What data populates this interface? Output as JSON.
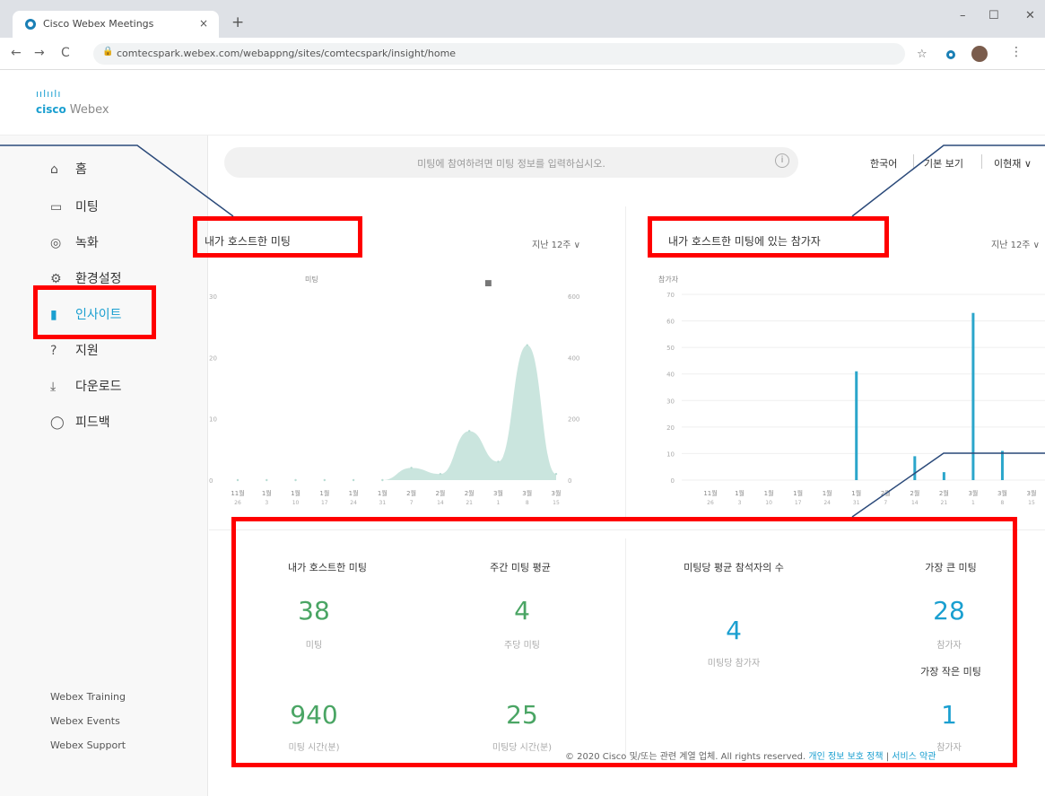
{
  "browser": {
    "tab_title": "Cisco Webex Meetings",
    "tab_close": "×",
    "new_tab": "+",
    "url": "comtecspark.webex.com/webappng/sites/comtecspark/insight/home",
    "minimize": "–",
    "maximize": "☐",
    "close": "✕",
    "back": "←",
    "forward": "→",
    "reload": "C",
    "star": "☆",
    "menu": "⋮"
  },
  "brand": {
    "bars": "ıılıılı",
    "cisco": "cisco",
    "product": "Webex"
  },
  "sidebar": {
    "items": [
      {
        "icon": "home-icon",
        "glyph": "⌂",
        "label": "홈"
      },
      {
        "icon": "calendar-icon",
        "glyph": "▭",
        "label": "미팅"
      },
      {
        "icon": "record-icon",
        "glyph": "◎",
        "label": "녹화"
      },
      {
        "icon": "gear-icon",
        "glyph": "⚙",
        "label": "환경설정"
      },
      {
        "icon": "bar-chart-icon",
        "glyph": "▮",
        "label": "인사이트"
      },
      {
        "icon": "help-icon",
        "glyph": "?",
        "label": "지원"
      },
      {
        "icon": "download-icon",
        "glyph": "⤓",
        "label": "다운로드"
      },
      {
        "icon": "feedback-icon",
        "glyph": "◯",
        "label": "피드백"
      }
    ],
    "footer_links": [
      "Webex Training",
      "Webex Events",
      "Webex Support"
    ]
  },
  "search": {
    "placeholder": "미팅에 참여하려면 미팅 정보를 입력하십시오.",
    "info": "i"
  },
  "header_links": {
    "language": "한국어",
    "classic_view": "기본 보기",
    "user": "이현재 ∨"
  },
  "panels": {
    "meetings_title": "내가 호스트한 미팅",
    "participants_title": "내가 호스트한 미팅에 있는 참가자",
    "period_label": "지난 12주 ∨",
    "period_label_short": "지난 12주 ∨"
  },
  "stats": {
    "hosted_label": "내가 호스트한 미팅",
    "hosted_value": "38",
    "hosted_unit": "미팅",
    "weekly_label": "주간 미팅 평균",
    "weekly_value": "4",
    "weekly_unit": "주당 미팅",
    "avg_participants_label": "미팅당 평균 참석자의 수",
    "avg_participants_value": "4",
    "avg_participants_unit": "미팅당 참가자",
    "largest_label": "가장 큰 미팅",
    "largest_value": "28",
    "largest_unit": "참가자",
    "smallest_label": "가장 작은 미팅",
    "smallest_value": "1",
    "smallest_unit": "참가자",
    "minutes_value": "940",
    "minutes_unit": "미팅 시간(분)",
    "per_meeting_value": "25",
    "per_meeting_unit": "미팅당 시간(분)"
  },
  "footer": {
    "copyright": "© 2020 Cisco 및/또는 관련 계열 업체. All rights reserved.",
    "privacy": "개인 정보 보호 정책",
    "sep": " | ",
    "terms": "서비스 약관"
  },
  "chart_data": [
    {
      "type": "area",
      "title": "",
      "ylabel": "미팅",
      "categories": [
        "11월 26",
        "1월 3",
        "1월 10",
        "1월 17",
        "1월 24",
        "1월 31",
        "2월 7",
        "2월 14",
        "2월 21",
        "3월 1",
        "3월 8",
        "3월 15"
      ],
      "ylim": [
        0,
        30
      ],
      "yticks": [
        "0",
        "10",
        "20",
        "30"
      ],
      "y2ticks": [
        "0",
        "200",
        "400",
        "600"
      ],
      "values": [
        0,
        0,
        0,
        0,
        0,
        0,
        2,
        1,
        8,
        3,
        22,
        1
      ],
      "color": "#b8dcd3",
      "legend_marker": "■"
    },
    {
      "type": "bar",
      "title": "",
      "ylabel": "참가자",
      "categories": [
        "11월 26",
        "1월 3",
        "1월 10",
        "1월 17",
        "1월 24",
        "1월 31",
        "2월 7",
        "2월 14",
        "2월 21",
        "3월 1",
        "3월 8",
        "3월 15"
      ],
      "ylim": [
        0,
        70
      ],
      "yticks": [
        "0",
        "10",
        "20",
        "30",
        "40",
        "50",
        "60",
        "70"
      ],
      "values": [
        0,
        0,
        0,
        0,
        0,
        41,
        0,
        9,
        3,
        63,
        11,
        0
      ],
      "color": "#2ba6cb"
    }
  ]
}
